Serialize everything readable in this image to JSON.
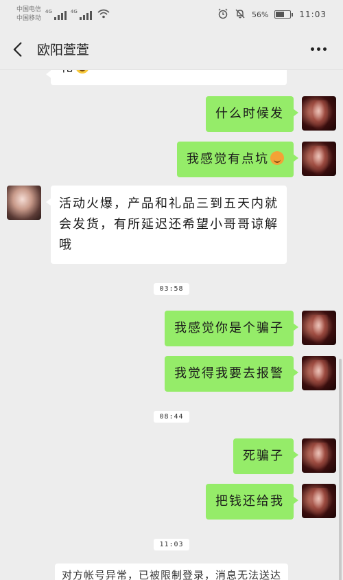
{
  "status_bar": {
    "carrier_1": "中国电信",
    "carrier_2": "中国移动",
    "signal_label_1": "4G",
    "signal_label_2": "4G",
    "battery": "56%",
    "battery_level": 0.56,
    "time": "11:03"
  },
  "header": {
    "title": "欧阳萱萱"
  },
  "messages": [
    {
      "side": "in",
      "text": "礼"
    },
    {
      "side": "out",
      "text": "什么时候发"
    },
    {
      "side": "out",
      "text": "我感觉有点坑"
    },
    {
      "side": "in",
      "text": "活动火爆，产品和礼品三到五天内就会发货，有所延迟还希望小哥哥谅解哦"
    },
    {
      "type": "time",
      "text": "03:58"
    },
    {
      "side": "out",
      "text": "我感觉你是个骗子"
    },
    {
      "side": "out",
      "text": "我觉得我要去报警"
    },
    {
      "type": "time",
      "text": "08:44"
    },
    {
      "side": "out",
      "text": "死骗子"
    },
    {
      "side": "out",
      "text": "把钱还给我"
    },
    {
      "type": "time",
      "text": "11:03"
    },
    {
      "type": "system",
      "text": "对方帐号异常，已被限制登录，消息无法送达"
    }
  ]
}
